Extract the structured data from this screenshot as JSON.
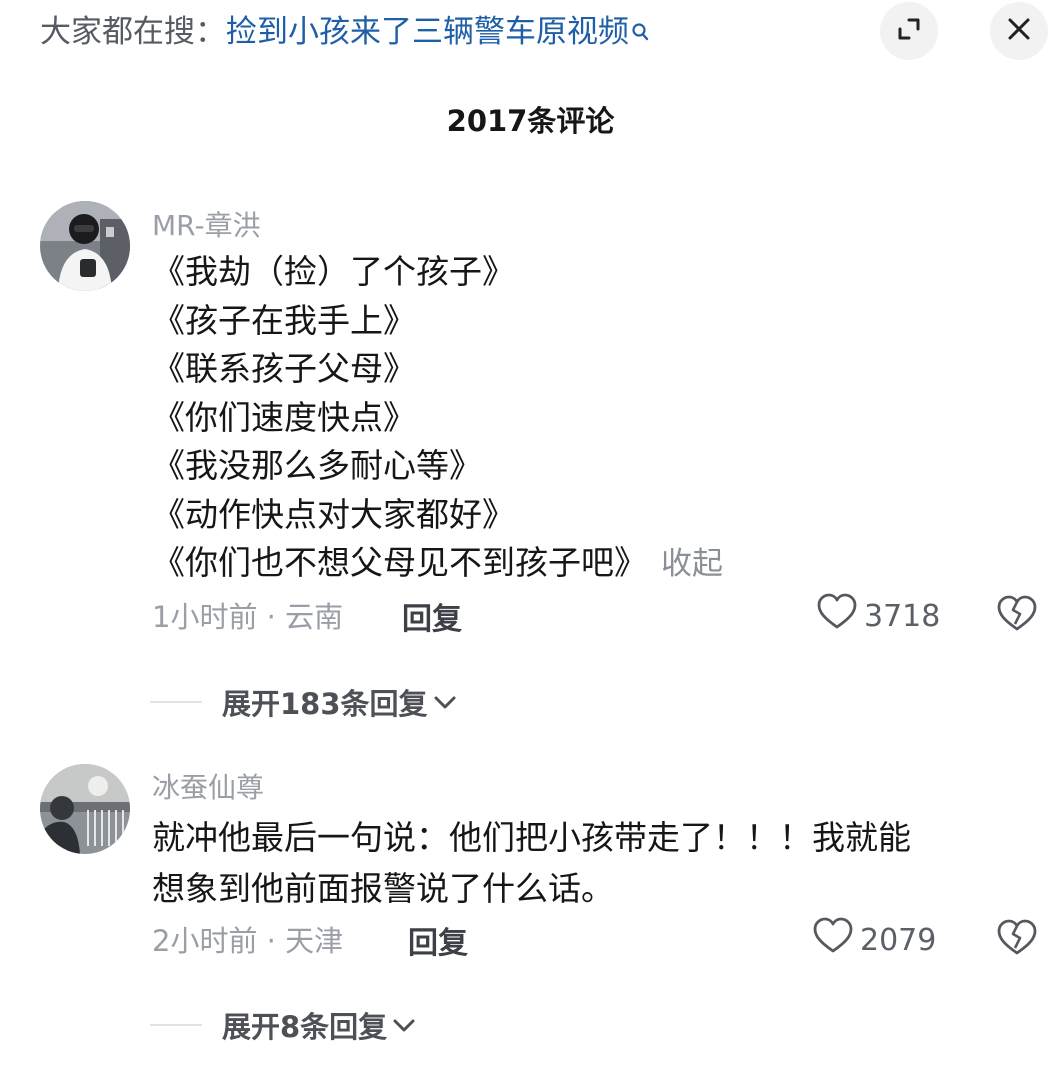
{
  "search_bar": {
    "prefix": "大家都在搜：",
    "query": "捡到小孩来了三辆警车原视频"
  },
  "header": {
    "title": "2017条评论"
  },
  "comments": [
    {
      "username": "MR-章洪",
      "lines": [
        "《我劫（捡）了个孩子》",
        "《孩子在我手上》",
        "《联系孩子父母》",
        "《你们速度快点》",
        "《我没那么多耐心等》",
        "《动作快点对大家都好》",
        "《你们也不想父母见不到孩子吧》"
      ],
      "collapse_label": "收起",
      "meta": "1小时前 · 云南",
      "reply_label": "回复",
      "likes": "3718",
      "expand_replies": "展开183条回复"
    },
    {
      "username": "冰蚕仙尊",
      "lines": [
        "就冲他最后一句说：他们把小孩带走了！！！我就能",
        "想象到他前面报警说了什么话。"
      ],
      "meta": "2小时前 · 天津",
      "reply_label": "回复",
      "likes": "2079",
      "expand_replies": "展开8条回复"
    }
  ]
}
